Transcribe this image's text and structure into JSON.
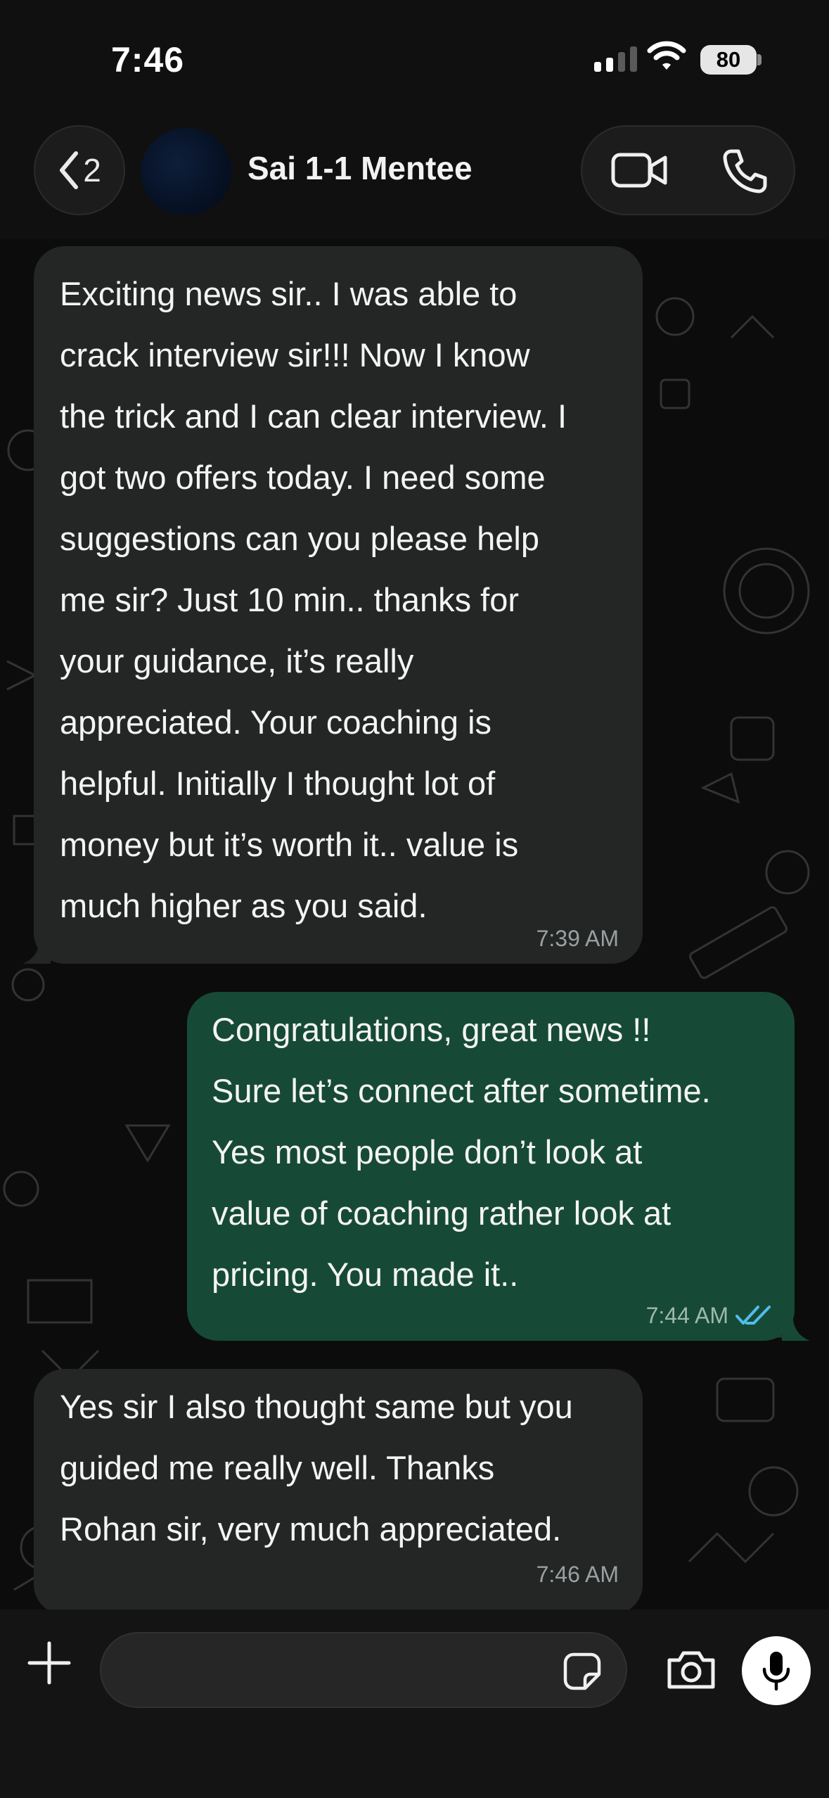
{
  "status_bar": {
    "time": "7:46",
    "battery": "80"
  },
  "header": {
    "back_count": "2",
    "contact_name": "Sai 1-1 Mentee"
  },
  "messages": [
    {
      "direction": "incoming",
      "text": "Exciting news sir.. I was able to\ncrack interview sir!!! Now I know\nthe trick and I can clear interview. I\ngot two offers today. I need some\nsuggestions can you please help\nme sir? Just 10 min.. thanks for\nyour guidance, it’s really\nappreciated. Your coaching is\nhelpful. Initially I thought lot of\nmoney but it’s worth it.. value is\nmuch higher as you said.",
      "time": "7:39 AM"
    },
    {
      "direction": "outgoing",
      "text": "Congratulations, great news !!\nSure let’s connect after sometime.\nYes most people don’t look at\nvalue of coaching rather look at\npricing. You made it..",
      "time": "7:44 AM",
      "status": "read"
    },
    {
      "direction": "incoming",
      "text": "Yes sir I also thought same but you\nguided me really well. Thanks\nRohan sir, very much appreciated.",
      "time": "7:46 AM"
    }
  ],
  "input": {
    "value": ""
  },
  "colors": {
    "incoming_bubble": "#242626",
    "outgoing_bubble": "#164a36",
    "read_ticks": "#53bdeb",
    "background": "#0b0b0b"
  },
  "icons": [
    "back-chevron-icon",
    "video-call-icon",
    "phone-call-icon",
    "plus-icon",
    "sticker-icon",
    "camera-icon",
    "microphone-icon",
    "signal-icon",
    "wifi-icon",
    "battery-icon",
    "double-check-icon"
  ]
}
